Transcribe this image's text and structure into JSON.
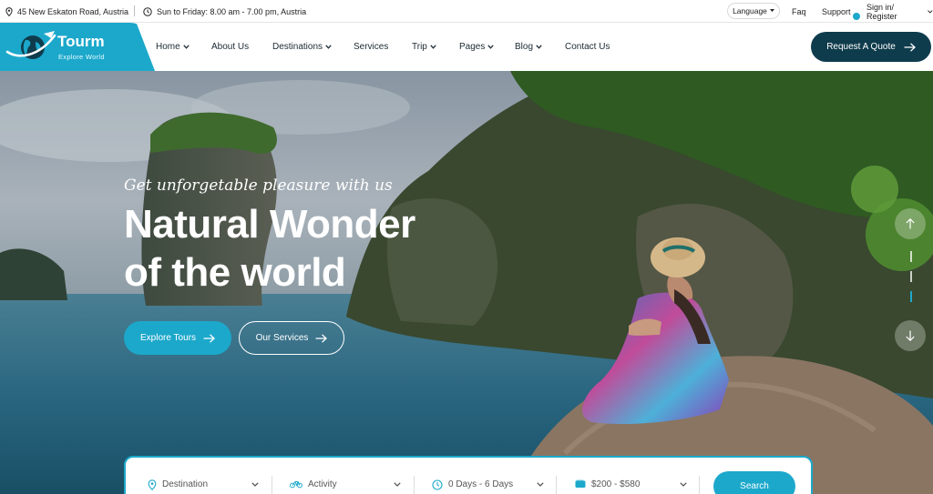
{
  "topbar": {
    "address": "45 New Eskaton Road, Austria",
    "hours": "Sun to Friday: 8.00 am - 7.00 pm, Austria",
    "language": "Language",
    "faq": "Faq",
    "support": "Support",
    "signin": "Sign in/ Register"
  },
  "brand": {
    "name": "Tourm",
    "tagline": "Explore World",
    "accent": "#1ca8cb",
    "dark": "#0f3c4c"
  },
  "nav": [
    {
      "label": "Home",
      "dropdown": true
    },
    {
      "label": "About Us",
      "dropdown": false
    },
    {
      "label": "Destinations",
      "dropdown": true
    },
    {
      "label": "Services",
      "dropdown": false
    },
    {
      "label": "Trip",
      "dropdown": true
    },
    {
      "label": "Pages",
      "dropdown": true
    },
    {
      "label": "Blog",
      "dropdown": true
    },
    {
      "label": "Contact Us",
      "dropdown": false
    }
  ],
  "cta": {
    "label": "Request A Quote",
    "icon": "arrow-right-icon"
  },
  "hero": {
    "tagline": "Get unforgetable pleasure with us",
    "title_line1": "Natural Wonder",
    "title_line2": "of the world",
    "primary_button": "Explore Tours",
    "secondary_button": "Our Services",
    "slider_prev_icon": "arrow-up-icon",
    "slider_next_icon": "arrow-down-icon"
  },
  "search": {
    "destination": {
      "label": "Destination",
      "icon": "map-pin-icon"
    },
    "activity": {
      "label": "Activity",
      "icon": "bicycle-icon"
    },
    "days": {
      "label": "0 Days - 6 Days",
      "icon": "clock-icon"
    },
    "price": {
      "label": "$200 - $580",
      "icon": "money-icon"
    },
    "button": "Search"
  }
}
